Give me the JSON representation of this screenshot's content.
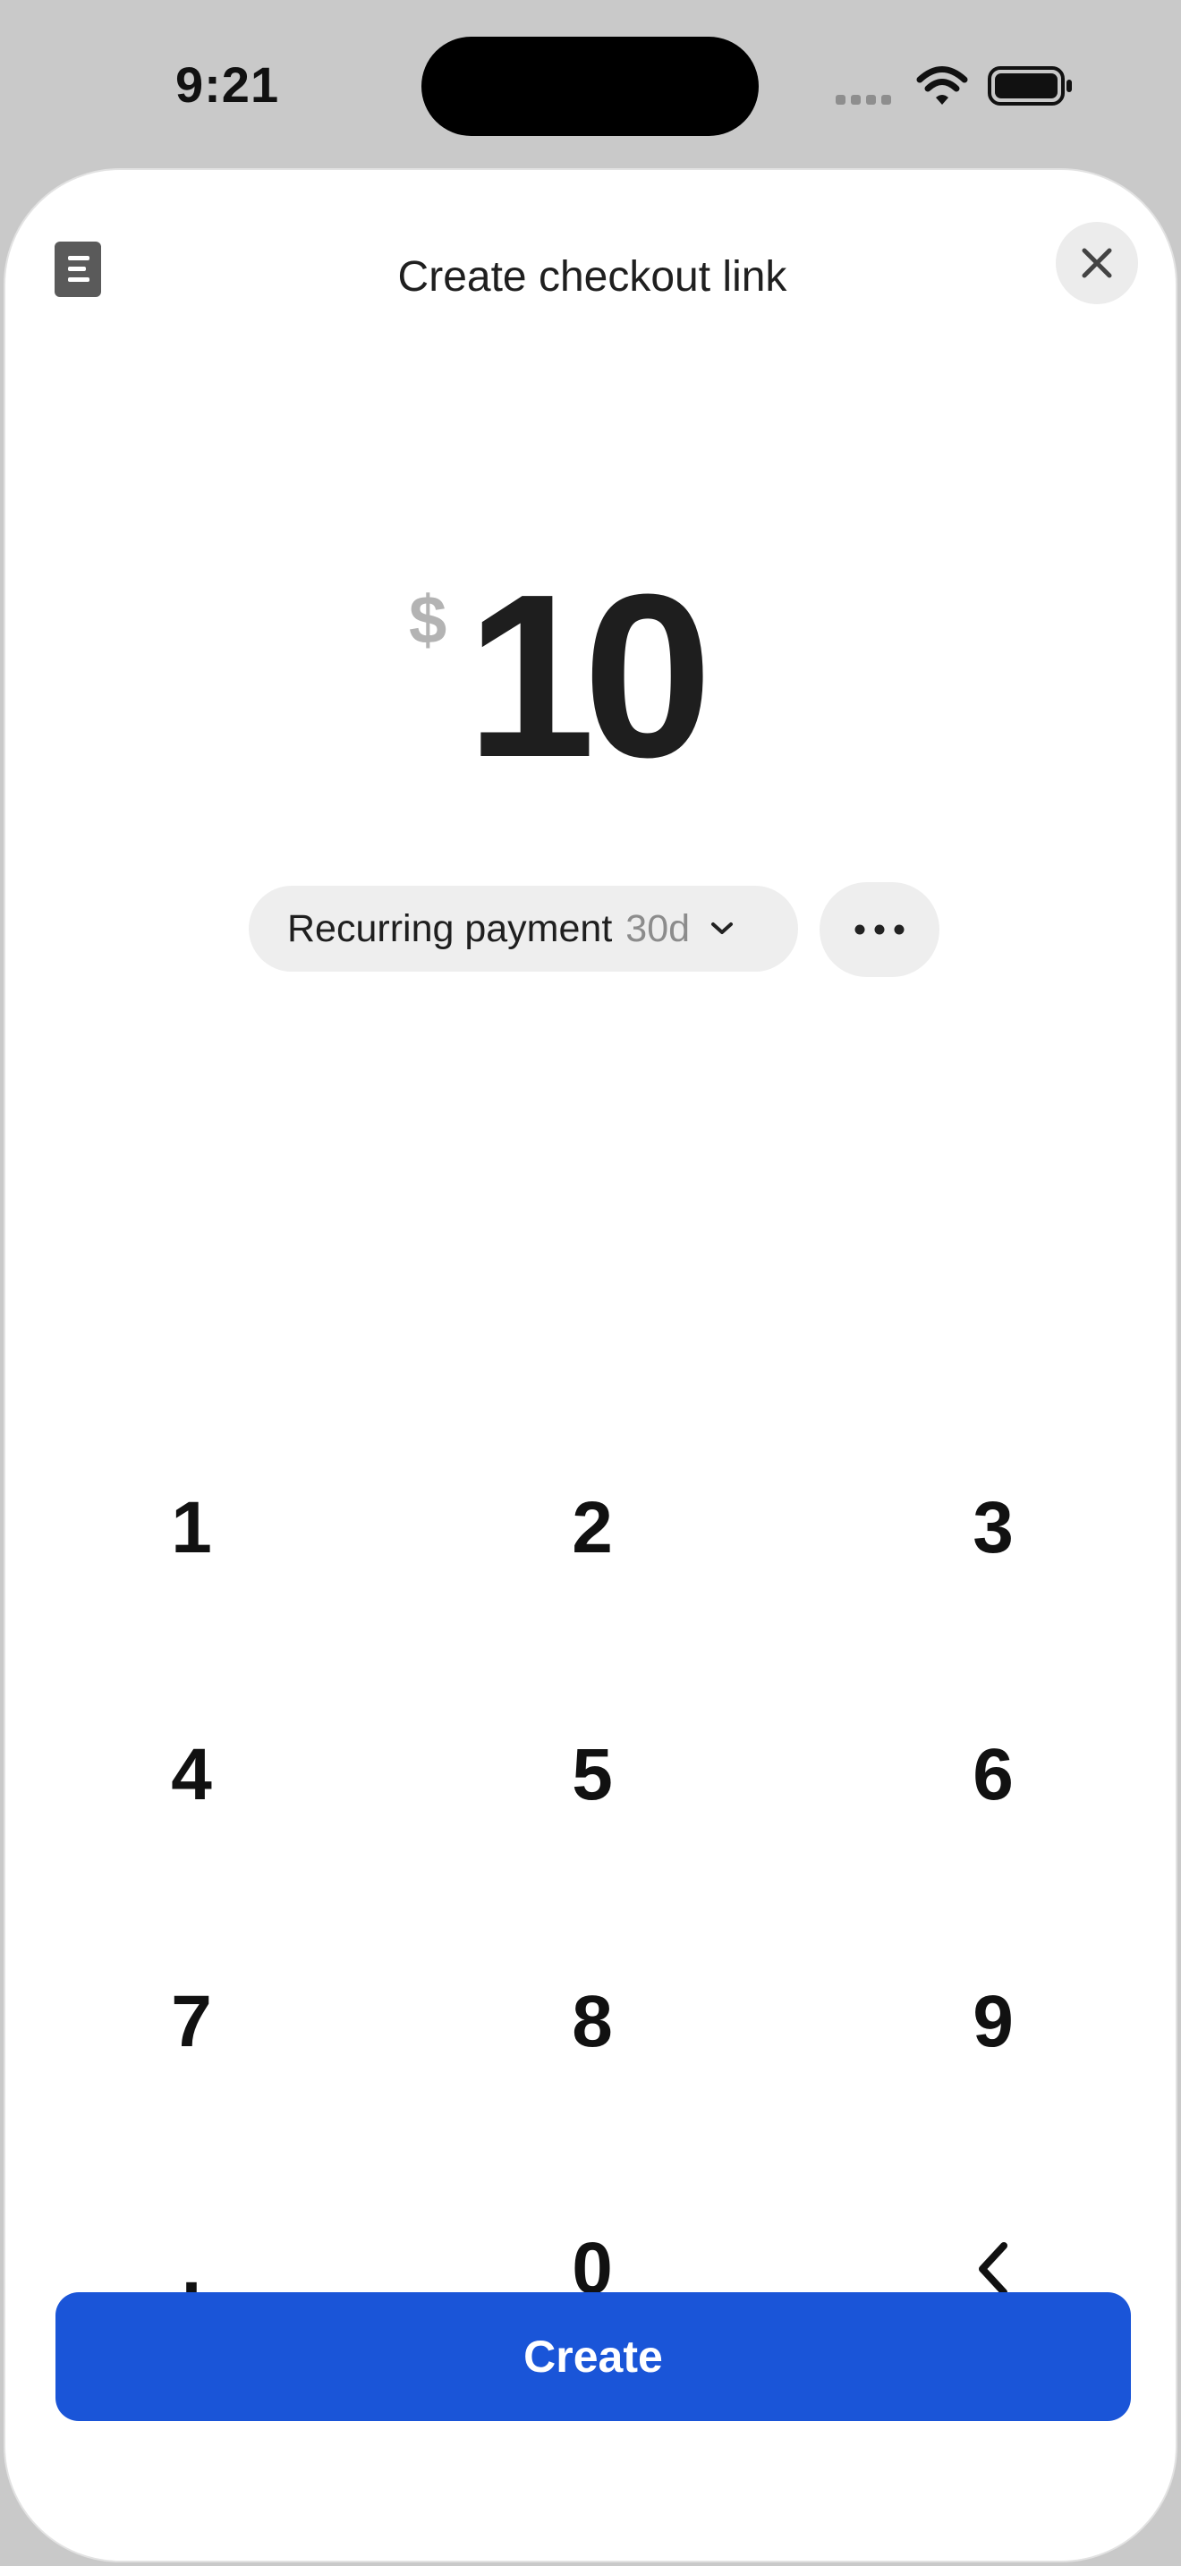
{
  "status_bar": {
    "time": "9:21",
    "icons": [
      "signal-icon",
      "wifi-icon",
      "battery-icon"
    ]
  },
  "header": {
    "title": "Create checkout link",
    "left_icon": "document-icon",
    "close_icon": "close-icon"
  },
  "amount": {
    "currency_symbol": "$",
    "value": "10"
  },
  "payment_options": {
    "type_label": "Recurring payment",
    "interval": "30d",
    "more_icon": "more-horizontal-icon"
  },
  "keypad": {
    "keys": [
      {
        "name": "key-1",
        "label": "1"
      },
      {
        "name": "key-2",
        "label": "2"
      },
      {
        "name": "key-3",
        "label": "3"
      },
      {
        "name": "key-4",
        "label": "4"
      },
      {
        "name": "key-5",
        "label": "5"
      },
      {
        "name": "key-6",
        "label": "6"
      },
      {
        "name": "key-7",
        "label": "7"
      },
      {
        "name": "key-8",
        "label": "8"
      },
      {
        "name": "key-9",
        "label": "9"
      },
      {
        "name": "key-decimal",
        "label": "."
      },
      {
        "name": "key-0",
        "label": "0"
      },
      {
        "name": "key-backspace",
        "label": "",
        "icon": "backspace-icon"
      }
    ]
  },
  "actions": {
    "create_label": "Create"
  },
  "colors": {
    "primary": "#1a55d8",
    "pill_bg": "#eeeeee",
    "muted_text": "#8c8c8c",
    "background": "#c9c9c9"
  }
}
